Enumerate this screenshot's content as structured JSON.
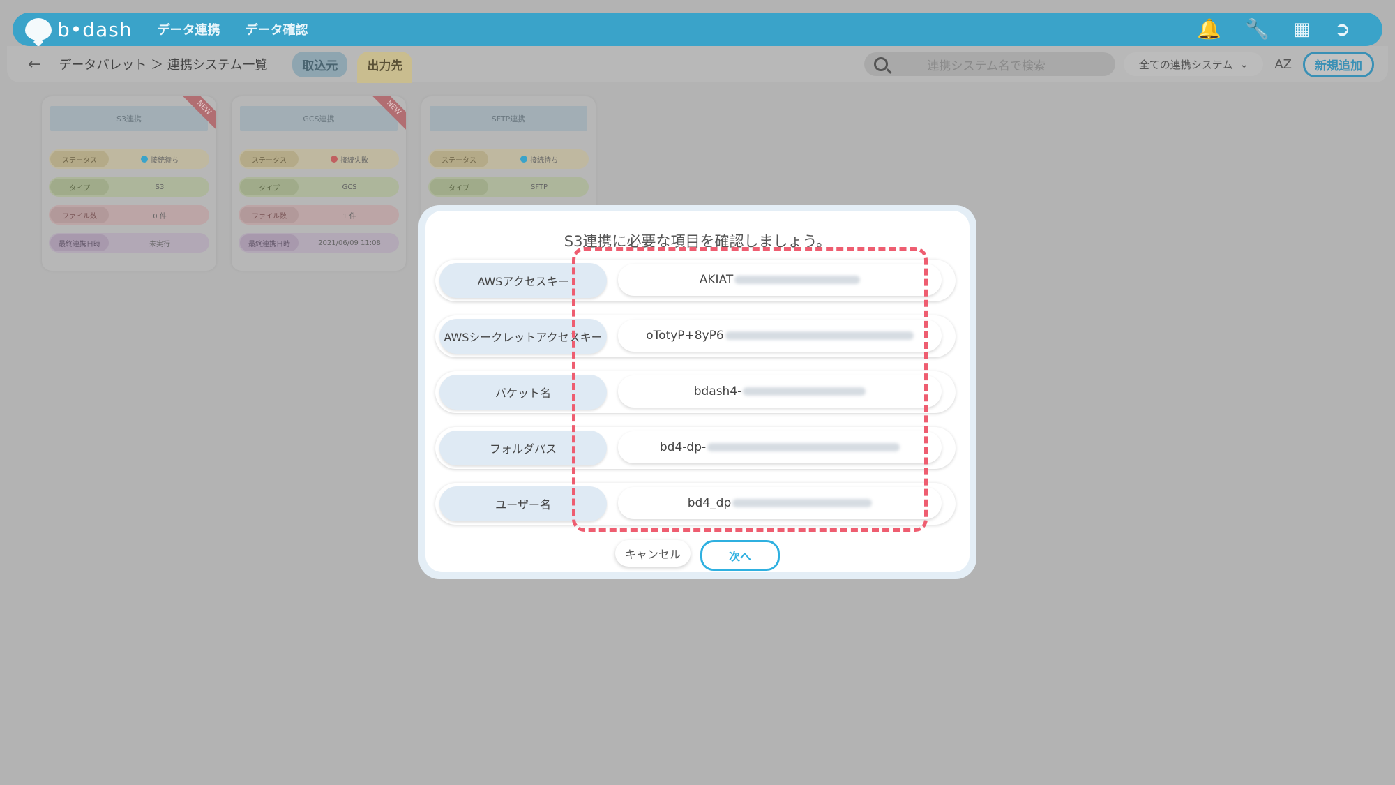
{
  "nav": {
    "logo": "b•dash",
    "items": [
      "データ連携",
      "データ確認"
    ],
    "icons": [
      "bell-icon",
      "wrench-icon",
      "grid-icon",
      "logout-icon"
    ]
  },
  "subnav": {
    "back_icon": "←",
    "breadcrumb": "データパレット ＞ 連携システム一覧",
    "tabs": [
      "取込元",
      "出力先"
    ],
    "search_placeholder": "連携システム名で検索",
    "filter": "全ての連携システム",
    "sort": "AZ",
    "add_button": "新規追加"
  },
  "cards": [
    {
      "title": "S3連携",
      "badge": "NEW",
      "status_label": "ステータス",
      "status_value": "接続待ち",
      "status_color": "#3aa3c9",
      "type_label": "タイプ",
      "type_value": "S3",
      "files_label": "ファイル数",
      "files_value": "0 件",
      "last_label": "最終連携日時",
      "last_value": "未実行"
    },
    {
      "title": "GCS連携",
      "badge": "NEW",
      "status_label": "ステータス",
      "status_value": "接続失敗",
      "status_color": "#c06060",
      "type_label": "タイプ",
      "type_value": "GCS",
      "files_label": "ファイル数",
      "files_value": "1 件",
      "last_label": "最終連携日時",
      "last_value": "2021/06/09 11:08"
    },
    {
      "title": "SFTP連携",
      "badge": "",
      "status_label": "ステータス",
      "status_value": "接続待ち",
      "status_color": "#3aa3c9",
      "type_label": "タイプ",
      "type_value": "SFTP"
    }
  ],
  "modal": {
    "title": "S3連携に必要な項目を確認しましょう。",
    "fields": [
      {
        "label": "AWSアクセスキー",
        "value": "AKIAT"
      },
      {
        "label": "AWSシークレットアクセスキー",
        "value": "oTotyP+8yP6"
      },
      {
        "label": "バケット名",
        "value": "bdash4-"
      },
      {
        "label": "フォルダパス",
        "value": "bd4-dp-"
      },
      {
        "label": "ユーザー名",
        "value": "bd4_dp"
      }
    ],
    "cancel": "キャンセル",
    "next": "次へ"
  },
  "colors": {
    "primary": "#3aa3c9",
    "highlight_dash": "#ee5d70"
  }
}
